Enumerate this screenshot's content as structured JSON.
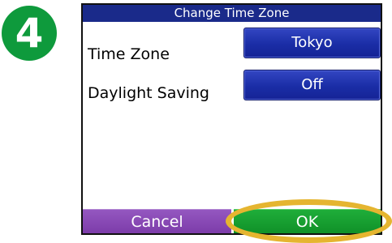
{
  "step": {
    "number": "4",
    "color": "#0e9a3c"
  },
  "window": {
    "title": "Change Time Zone"
  },
  "fields": [
    {
      "label": "Time Zone",
      "value": "Tokyo"
    },
    {
      "label": "Daylight Saving",
      "value": "Off"
    }
  ],
  "buttons": {
    "cancel_label": "Cancel",
    "ok_label": "OK"
  },
  "colors": {
    "title_bar": "#1a2a8a",
    "value_button": "#1a2da6",
    "cancel_button": "#7b3aa8",
    "ok_button": "#0f8f27",
    "highlight_ring": "#e5b530"
  }
}
